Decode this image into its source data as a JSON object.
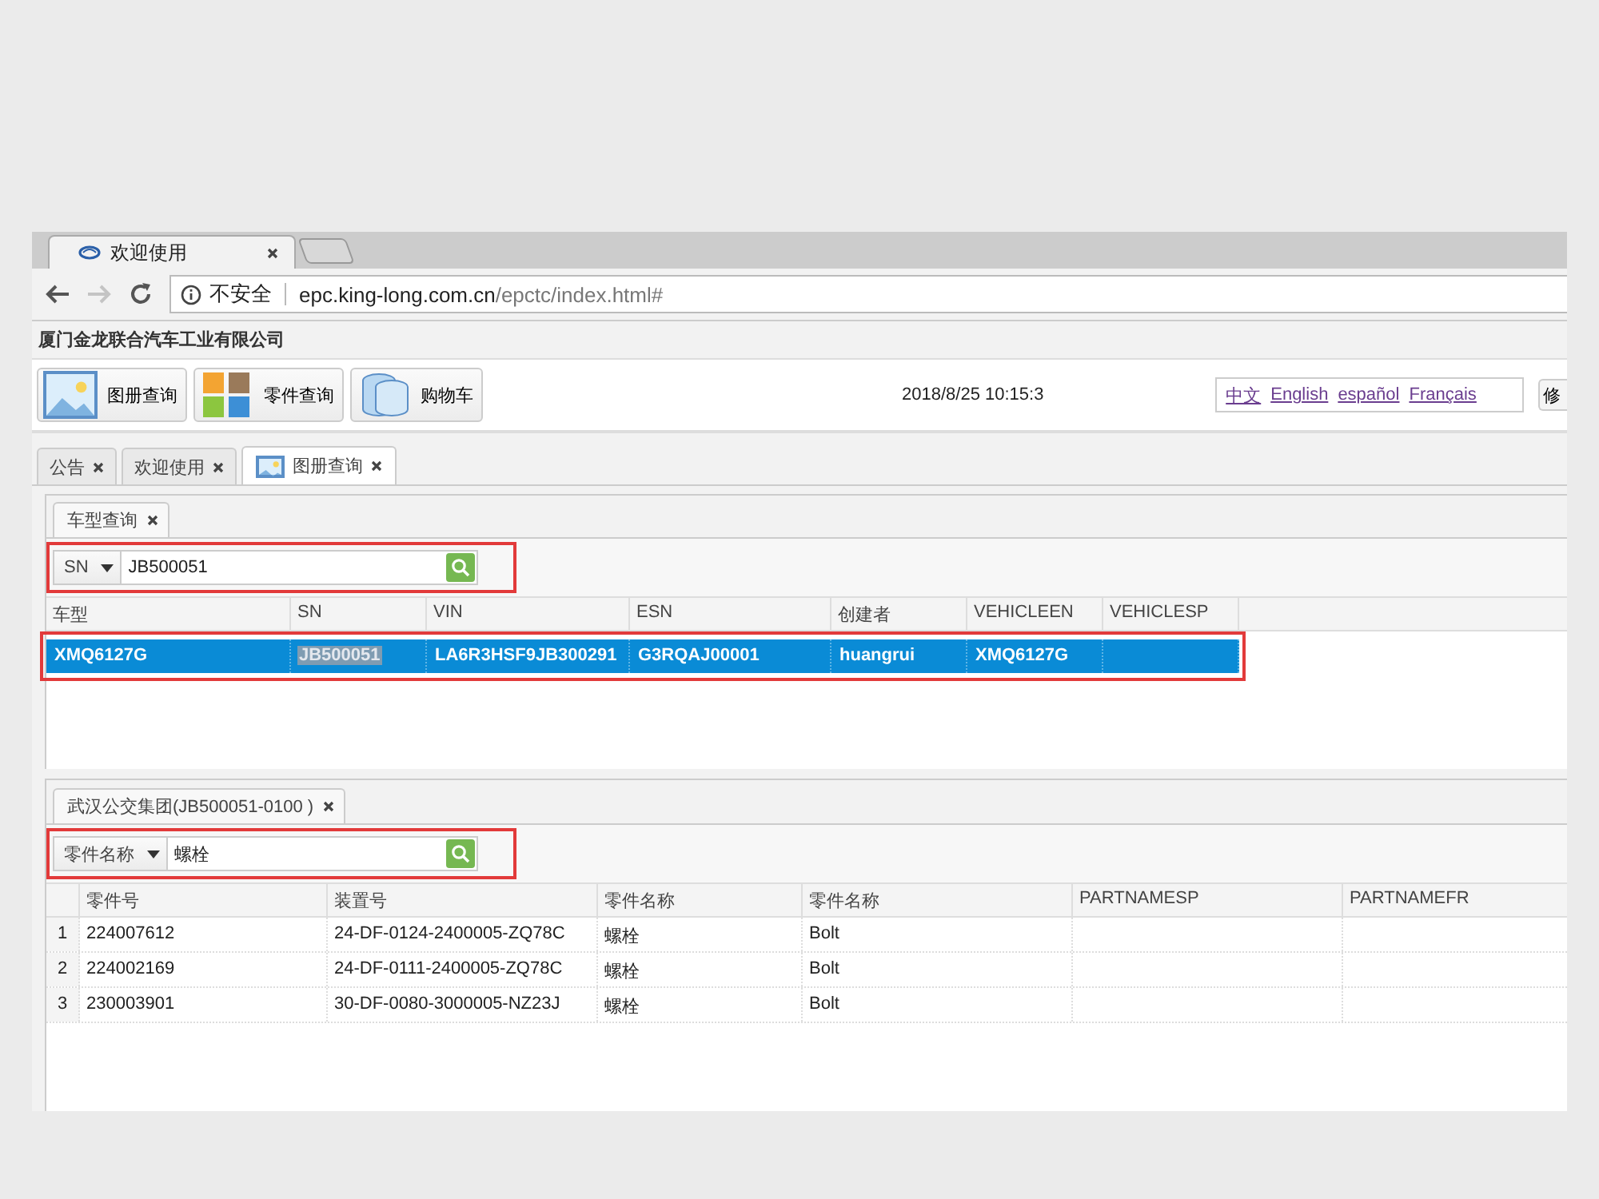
{
  "browser": {
    "tab": {
      "title": "欢迎使用"
    },
    "forward_disabled": true,
    "address": {
      "security": "不安全",
      "host": "epc.king-long.com.cn",
      "path": "/epctc/index.html#"
    }
  },
  "app": {
    "company": "厦门金龙联合汽车工业有限公司",
    "toolbar": [
      {
        "label": "图册查询",
        "kind": "picture"
      },
      {
        "label": "零件查询",
        "kind": "tiles"
      },
      {
        "label": "购物车",
        "kind": "cylinder"
      }
    ],
    "datetime": "2018/8/25 10:15:3",
    "languages": [
      "中文",
      "English",
      "español",
      "Français"
    ],
    "cut_button": "修"
  },
  "tabs": [
    {
      "label": "公告",
      "selected": false
    },
    {
      "label": "欢迎使用",
      "selected": false
    },
    {
      "label": "图册查询",
      "selected": true,
      "kind": "picture"
    }
  ],
  "vehicle_panel": {
    "tab": "车型查询",
    "search": {
      "field": "SN",
      "value": "JB500051",
      "highlighted": true
    },
    "columns": [
      "车型",
      "SN",
      "VIN",
      "ESN",
      "创建者",
      "VEHICLEEN",
      "VEHICLESP"
    ],
    "rows": [
      {
        "selected": true,
        "highlighted": true,
        "cells": [
          {
            "text": "XMQ6127G",
            "marked": false
          },
          {
            "text": "JB500051",
            "marked": true
          },
          {
            "text": "LA6R3HSF9JB300291",
            "marked": false
          },
          {
            "text": "G3RQAJ00001",
            "marked": false
          },
          {
            "text": "huangrui",
            "marked": false
          },
          {
            "text": "XMQ6127G",
            "marked": false
          }
        ]
      }
    ]
  },
  "parts_panel": {
    "tab": "武汉公交集团(JB500051-0100 )",
    "search": {
      "field": "零件名称",
      "value": "螺栓",
      "highlighted": true
    },
    "columns": [
      "零件号",
      "装置号",
      "零件名称",
      "零件名称",
      "PARTNAMESP",
      "PARTNAMEFR"
    ],
    "rows": [
      {
        "number": "1",
        "cells": [
          "224007612",
          "24-DF-0124-2400005-ZQ78C",
          "螺栓",
          "Bolt"
        ]
      },
      {
        "number": "2",
        "cells": [
          "224002169",
          "24-DF-0111-2400005-ZQ78C",
          "螺栓",
          "Bolt"
        ]
      },
      {
        "number": "3",
        "cells": [
          "230003901",
          "30-DF-0080-3000005-NZ23J",
          "螺栓",
          "Bolt"
        ]
      }
    ]
  }
}
